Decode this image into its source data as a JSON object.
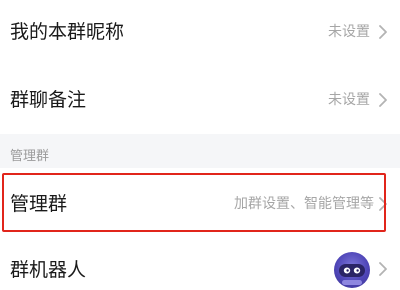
{
  "settings": {
    "nickname": {
      "label": "我的本群昵称",
      "value": "未设置"
    },
    "remark": {
      "label": "群聊备注",
      "value": "未设置"
    },
    "manage_section": {
      "title": "管理群"
    },
    "manage": {
      "label": "管理群",
      "value": "加群设置、智能管理等"
    },
    "robot": {
      "label": "群机器人",
      "avatar_icon": "robot-avatar-icon"
    }
  },
  "colors": {
    "highlight_border": "#e1251b",
    "secondary_text": "#a6a6a6",
    "section_background": "#f5f6f8"
  }
}
